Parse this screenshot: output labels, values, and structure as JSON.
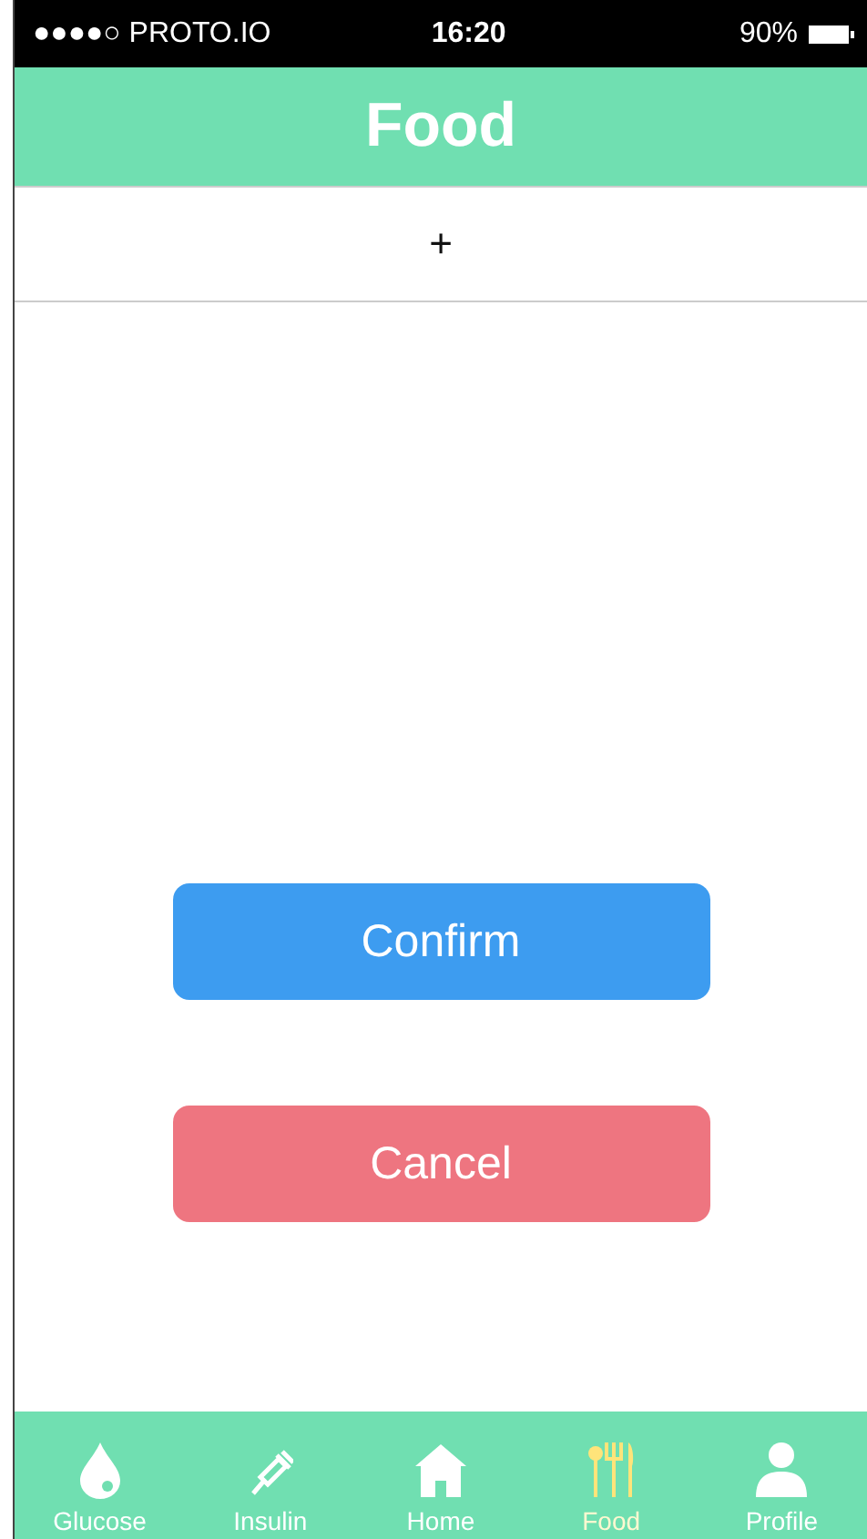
{
  "status_bar": {
    "carrier": "●●●●○ PROTO.IO",
    "time": "16:20",
    "battery": "90%"
  },
  "header": {
    "title": "Food"
  },
  "add_row": {
    "label": "+"
  },
  "buttons": [
    {
      "label": "Confirm",
      "kind": "confirm"
    },
    {
      "label": "Cancel",
      "kind": "cancel"
    }
  ],
  "tab_bar": [
    {
      "label": "Glucose",
      "kind": "drop",
      "selected": false
    },
    {
      "label": "Insulin",
      "kind": "syringe",
      "selected": false
    },
    {
      "label": "Home",
      "kind": "house",
      "selected": false
    },
    {
      "label": "Food",
      "kind": "cutlery",
      "selected": true
    },
    {
      "label": "Profile",
      "kind": "person",
      "selected": false
    }
  ]
}
